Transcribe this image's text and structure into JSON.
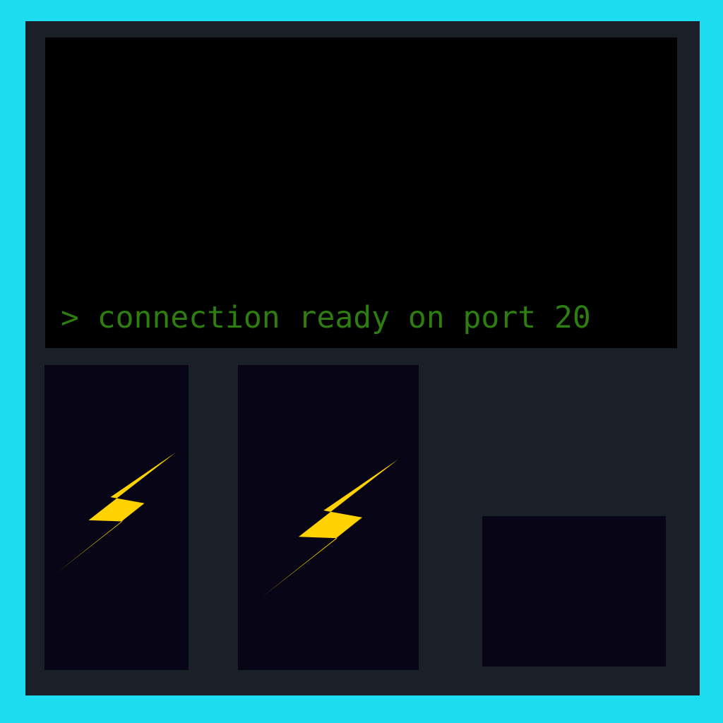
{
  "terminal": {
    "prompt": ">",
    "message": "connection ready on port 20",
    "text_color": "#2d7d10",
    "background": "#000000"
  },
  "panels": [
    {
      "icon": "lightning-bolt-icon"
    },
    {
      "icon": "lightning-bolt-icon"
    },
    {
      "icon": ""
    }
  ],
  "colors": {
    "outer_background": "#1cdcef",
    "frame": "#1a1f28",
    "panel": "#080616",
    "bolt": "#ffd200"
  }
}
